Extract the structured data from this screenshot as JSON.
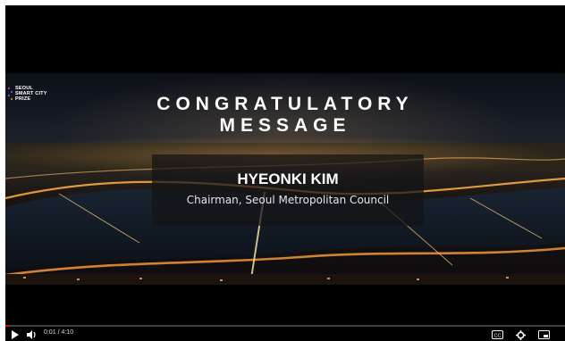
{
  "logo": {
    "lines": [
      "SEOUL",
      "SMART CITY",
      "PRIZE"
    ]
  },
  "title": {
    "line1": "CONGRATULATORY",
    "line2": "MESSAGE"
  },
  "speaker": {
    "name": "HYEONKI KIM",
    "role": "Chairman, Seoul Metropolitan Council"
  },
  "player": {
    "time_label": "0:01 / 4:10",
    "progress_percent": 0.4,
    "icons": [
      "play-icon",
      "volume-icon",
      "captions-icon",
      "settings-icon",
      "miniplayer-icon"
    ]
  },
  "colors": {
    "progress": "#ff0000",
    "logo_dots": [
      "#e8477a",
      "#8b5cf6",
      "#3b82f6",
      "#f59e0b"
    ]
  }
}
